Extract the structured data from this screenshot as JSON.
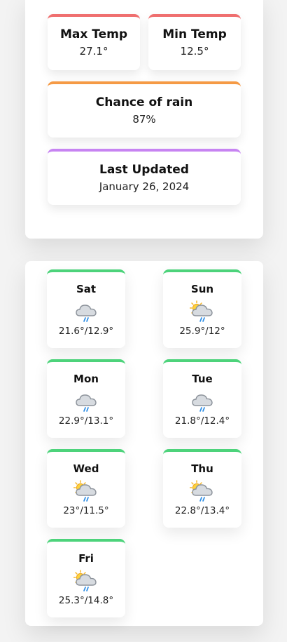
{
  "stats": {
    "max_temp": {
      "label": "Max Temp",
      "value": "27.1°",
      "accent": "#ef6f6f"
    },
    "min_temp": {
      "label": "Min Temp",
      "value": "12.5°",
      "accent": "#ef6f6f"
    },
    "rain": {
      "label": "Chance of rain",
      "value": "87%",
      "accent": "#f59a45"
    },
    "updated": {
      "label": "Last Updated",
      "value": "January 26, 2024",
      "accent": "#c784f2"
    }
  },
  "forecast": {
    "accent": "#4dd37b",
    "days": [
      {
        "day": "Sat",
        "range": "21.6°/12.9°",
        "icon": "cloud-rain-icon"
      },
      {
        "day": "Sun",
        "range": "25.9°/12°",
        "icon": "sun-cloud-rain-icon"
      },
      {
        "day": "Mon",
        "range": "22.9°/13.1°",
        "icon": "cloud-rain-icon"
      },
      {
        "day": "Tue",
        "range": "21.8°/12.4°",
        "icon": "cloud-rain-icon"
      },
      {
        "day": "Wed",
        "range": "23°/11.5°",
        "icon": "sun-cloud-rain-icon"
      },
      {
        "day": "Thu",
        "range": "22.8°/13.4°",
        "icon": "sun-cloud-rain-icon"
      },
      {
        "day": "Fri",
        "range": "25.3°/14.8°",
        "icon": "sun-cloud-rain-icon"
      }
    ]
  }
}
